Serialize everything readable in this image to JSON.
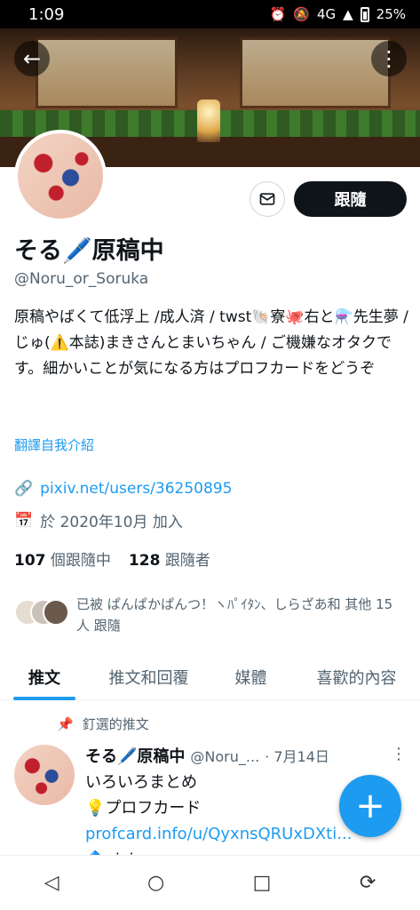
{
  "status_bar": {
    "time": "1:09",
    "network": "4G",
    "battery": "25%"
  },
  "header": {
    "back_icon": "arrow-left-icon",
    "more_icon": "more-vertical-icon"
  },
  "profile": {
    "display_name": "そる🖊️原稿中",
    "handle": "@Noru_or_Soruka",
    "follow_label": "跟隨",
    "bio": "原稿やばくて低浮上 /成人済 / twst🐚寮🐙右と⚗️先生夢 / じゅ(⚠️本誌)まきさんとまいちゃん / ご機嫌なオタクです。細かいことが気になる方はプロフカードをどうぞ",
    "translate_label": "翻譯自我介紹",
    "website": "pixiv.net/users/36250895",
    "joined": "於 2020年10月 加入",
    "following_count": "107",
    "following_label": "個跟隨中",
    "followers_count": "128",
    "followers_label": "跟隨者",
    "followed_by": "已被 ぱんぱかぱんつ！ヽﾊﾟｲﾀﾝ、しらざあ和 其他 15 人 跟隨"
  },
  "tabs": [
    {
      "label": "推文",
      "active": true
    },
    {
      "label": "推文和回覆",
      "active": false
    },
    {
      "label": "媒體",
      "active": false
    },
    {
      "label": "喜歡的內容",
      "active": false
    }
  ],
  "pinned_tweet": {
    "pinned_label": "釘選的推文",
    "name": "そる🖊️原稿中",
    "handle": "@Noru_...",
    "date": "· 7月14日",
    "line1": "いろいろまとめ",
    "line2": "💡プロフカード",
    "link": "profcard.info/u/QyxnsQRUxDXti...",
    "line4": "🔷pixiv"
  },
  "fab": {
    "label": "+"
  },
  "nav": {
    "back": "◁",
    "home": "○",
    "recents": "□",
    "rotate": "⟳"
  },
  "colors": {
    "accent": "#1d9bf0",
    "text": "#0f1419",
    "muted": "#536471"
  }
}
